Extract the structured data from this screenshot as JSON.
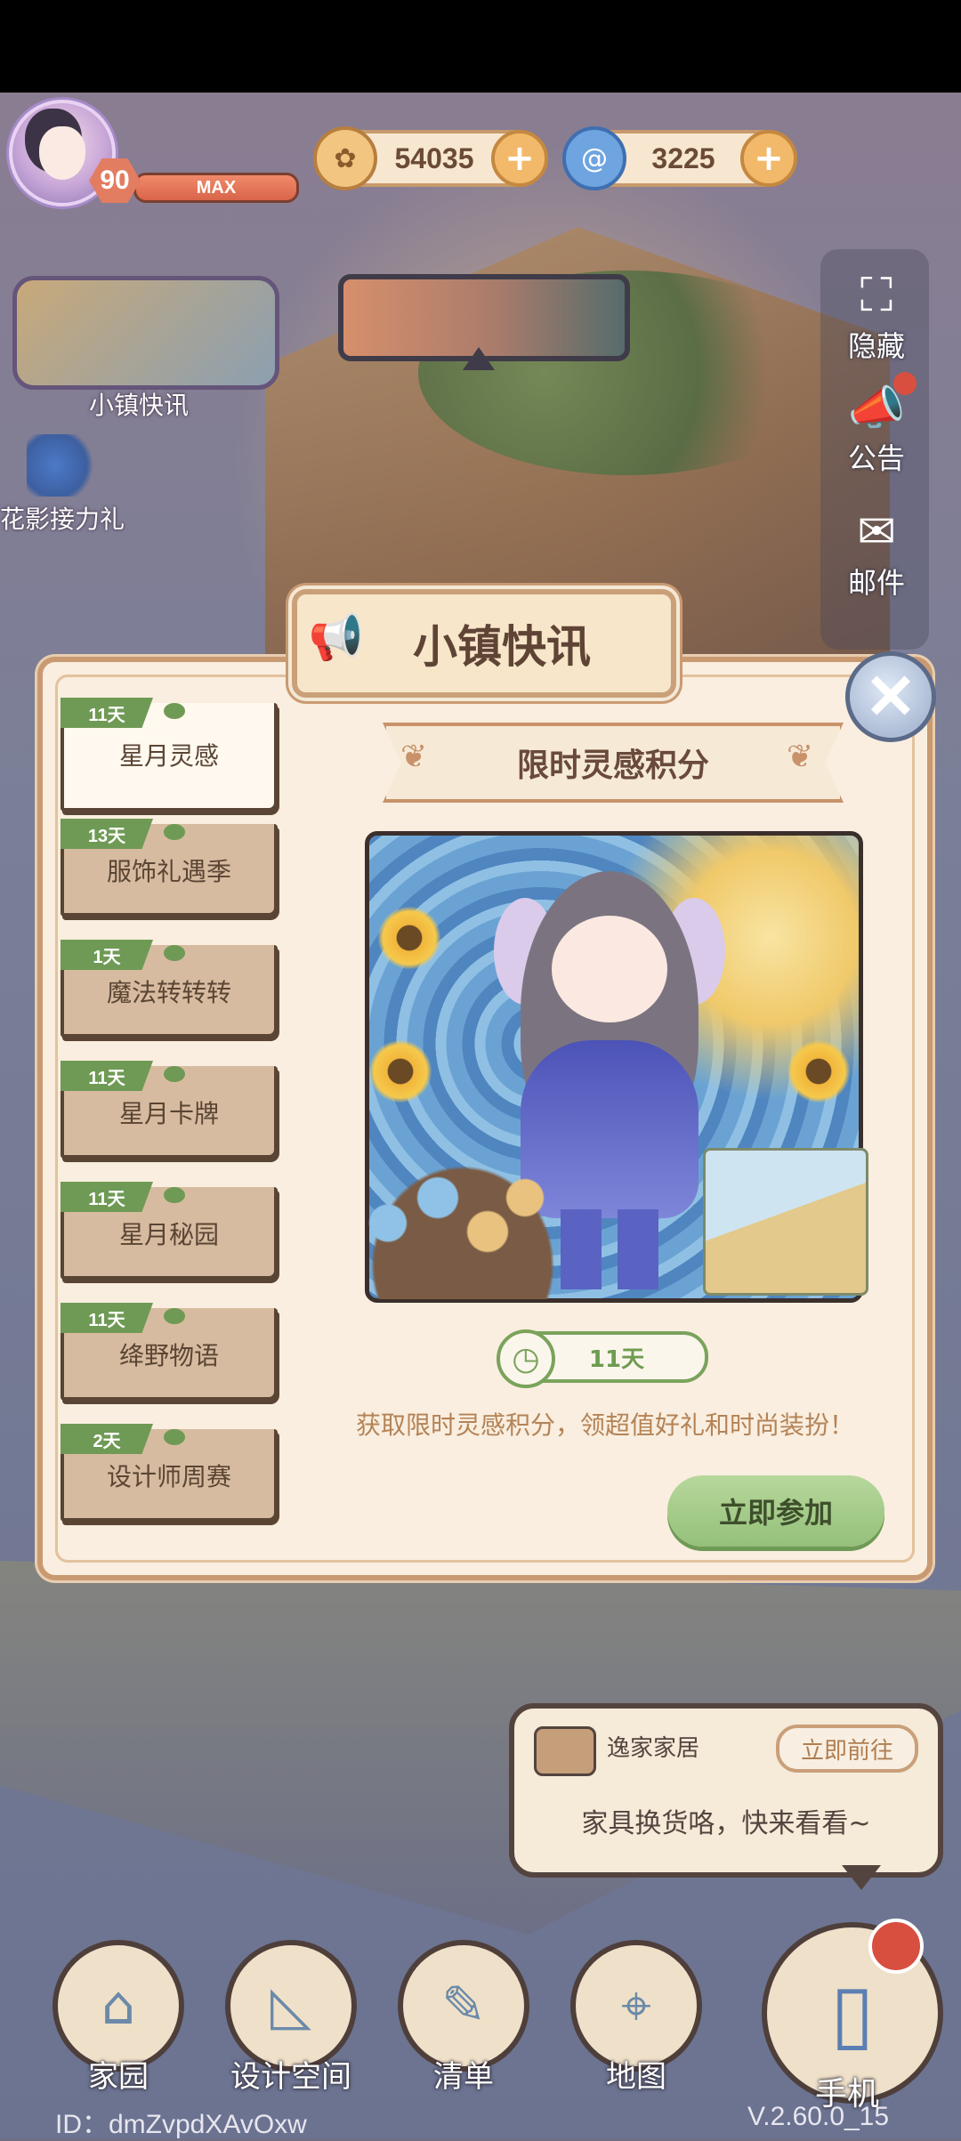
{
  "player": {
    "level": "90",
    "level_status": "MAX"
  },
  "currency": {
    "coins": {
      "icon": "coin-icon",
      "value": "54035"
    },
    "inspiration": {
      "icon": "swirl-icon",
      "value": "3225"
    }
  },
  "left_menu": {
    "news_label": "小镇快讯",
    "relay_label": "花影接力礼"
  },
  "right_menu": {
    "hide_label": "隐藏",
    "notice_label": "公告",
    "mail_label": "邮件"
  },
  "modal": {
    "title": "小镇快讯",
    "tabs": [
      {
        "days": "11天",
        "name": "星月灵感",
        "active": true
      },
      {
        "days": "13天",
        "name": "服饰礼遇季"
      },
      {
        "days": "1天",
        "name": "魔法转转转"
      },
      {
        "days": "11天",
        "name": "星月卡牌"
      },
      {
        "days": "11天",
        "name": "星月秘园"
      },
      {
        "days": "11天",
        "name": "绛野物语"
      },
      {
        "days": "2天",
        "name": "设计师周赛"
      }
    ],
    "event_title": "限时灵感积分",
    "remaining": "11天",
    "description": "获取限时灵感积分，领超值好礼和时尚装扮！",
    "join_label": "立即参加"
  },
  "notice_bubble": {
    "source": "逸家家居",
    "go_label": "立即前往",
    "message": "家具换货咯，快来看看~"
  },
  "bottom_nav": {
    "home": "家园",
    "design": "设计空间",
    "list": "清单",
    "map": "地图",
    "phone": "手机"
  },
  "footer": {
    "id_text": "ID：dmZvpdXAvOxw",
    "version": "V.2.60.0_15"
  }
}
